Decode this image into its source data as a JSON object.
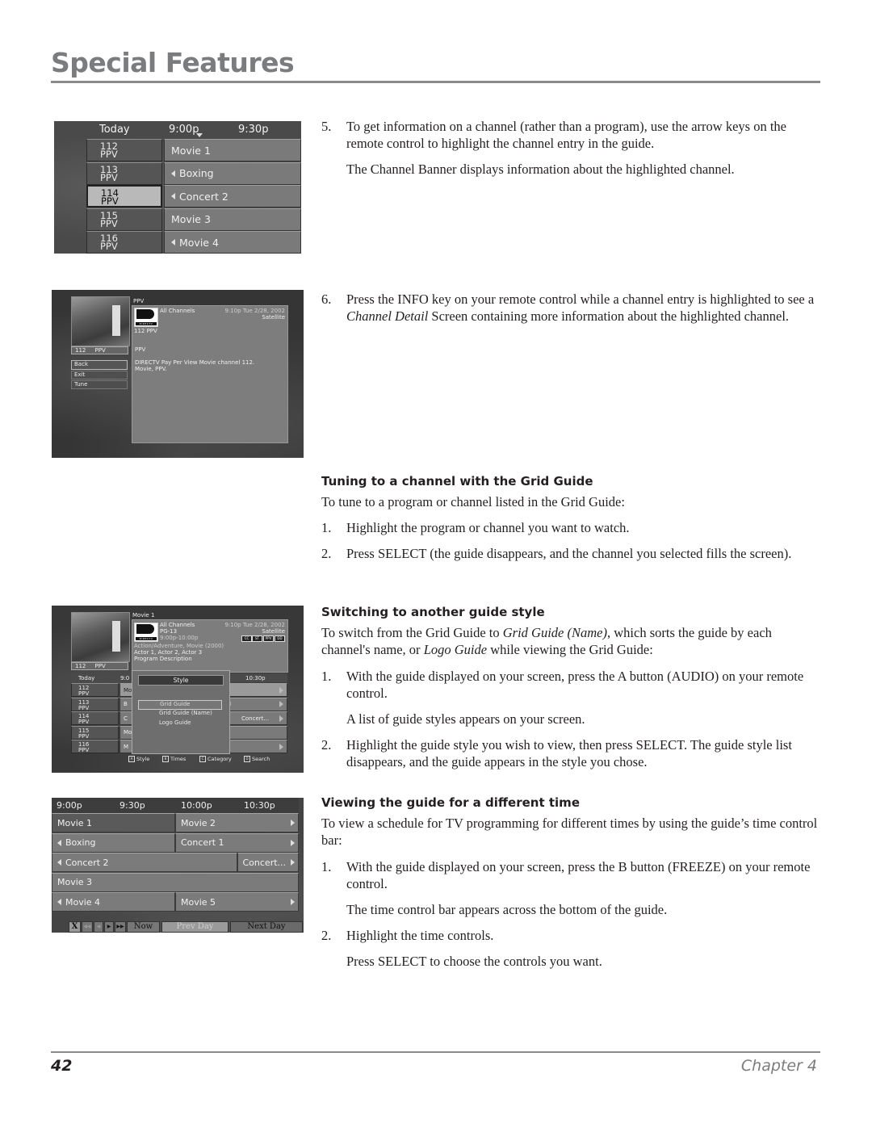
{
  "header": {
    "title": "Special Features"
  },
  "footer": {
    "page_number": "42",
    "chapter": "Chapter 4"
  },
  "text": {
    "step5": {
      "num": "5.",
      "text": "To get information on a channel (rather than a program), use the arrow keys on the remote control to highlight the channel entry in the guide."
    },
    "step5_note": "The Channel Banner displays information about the highlighted channel.",
    "step6": {
      "num": "6.",
      "pre": "Press the INFO key on your remote control while a channel entry is highlighted to see a ",
      "em": "Channel Detail",
      "post": " Screen containing more information about the highlighted channel."
    },
    "tuning": {
      "heading": "Tuning to a channel with the Grid Guide",
      "intro": "To tune to a program or channel listed in the Grid Guide:",
      "steps": [
        {
          "num": "1.",
          "text": "Highlight the program or channel you want to watch."
        },
        {
          "num": "2.",
          "text": "Press SELECT (the guide disappears, and the channel you selected fills the screen)."
        }
      ]
    },
    "switching": {
      "heading": "Switching to another guide style",
      "intro_pre": "To switch from the Grid Guide to ",
      "intro_em1": "Grid Guide (Name)",
      "intro_mid": ", which sorts the guide by each channel's name, or ",
      "intro_em2": "Logo Guide",
      "intro_post": " while viewing the Grid Guide:",
      "steps": [
        {
          "num": "1.",
          "text": "With the guide displayed on your screen, press the A button (AUDIO) on your remote control."
        },
        {
          "num": "2.",
          "text": "Highlight the guide style you wish to view, then press SELECT. The guide style list disappears, and the guide appears in the style you chose."
        }
      ],
      "step1_note": "A list of guide styles appears on your screen."
    },
    "viewing": {
      "heading": "Viewing the guide for a different time",
      "intro": "To view a schedule for TV programming for different times by using the guide’s time control bar:",
      "steps": [
        {
          "num": "1.",
          "text": "With the guide displayed on your screen, press the B button (FREEZE) on your remote control."
        },
        {
          "num": "2.",
          "text": "Highlight the time controls."
        }
      ],
      "step1_note": "The time control bar appears across the bottom of the guide.",
      "step2_note": "Press SELECT to choose the controls you want."
    }
  },
  "screen1": {
    "header": {
      "day": "Today",
      "time1": "9:00p",
      "time2": "9:30p"
    },
    "rows": [
      {
        "channel": "112",
        "type": "PPV",
        "program": "Movie 1",
        "continues_left": false,
        "selected": false
      },
      {
        "channel": "113",
        "type": "PPV",
        "program": "Boxing",
        "continues_left": true,
        "selected": false
      },
      {
        "channel": "114",
        "type": "PPV",
        "program": "Concert 2",
        "continues_left": true,
        "selected": true
      },
      {
        "channel": "115",
        "type": "PPV",
        "program": "Movie 3",
        "continues_left": false,
        "selected": false
      },
      {
        "channel": "116",
        "type": "PPV",
        "program": "Movie 4",
        "continues_left": true,
        "selected": false
      }
    ]
  },
  "screen2": {
    "section_label": "PPV",
    "thumb_label": {
      "channel": "112",
      "type": "PPV"
    },
    "menu": [
      "Back",
      "Exit",
      "Tune"
    ],
    "info": {
      "list": "All Channels",
      "datetime": "9:10p Tue 2/28, 2002",
      "source": "Satellite",
      "logo": "DIRECTV",
      "channel_line": "112  PPV",
      "name": "PPV",
      "description": "DIRECTV Pay Per View Movie channel 112. Movie, PPV."
    }
  },
  "screen3": {
    "program_title": "Movie 1",
    "info": {
      "list": "All Channels",
      "rating": "PG-13",
      "time": "9:00p-10:00p",
      "datetime": "9:10p Tue 2/28, 2002",
      "source": "Satellite",
      "logo": "DIRECTV",
      "genre": "Action/Adventure, Movie (2000)",
      "actors": "Actor 1, Actor 2, Actor 3",
      "description": "Program Description",
      "icons": [
        "cc-icon",
        "stereo-icon",
        "ppv-icon",
        "dd-icon"
      ],
      "icon_labels": [
        "CC",
        "ST",
        "PPV",
        "DD"
      ]
    },
    "thumb_label": {
      "channel": "112",
      "type": "PPV"
    },
    "grid_header": {
      "day": "Today",
      "time1": "9:0",
      "time2": "10:30p"
    },
    "channels": [
      {
        "channel": "112",
        "type": "PPV",
        "prog": "Mo"
      },
      {
        "channel": "113",
        "type": "PPV",
        "prog": "B"
      },
      {
        "channel": "114",
        "type": "PPV",
        "prog": "C"
      },
      {
        "channel": "115",
        "type": "PPV",
        "prog": "Mo"
      },
      {
        "channel": "116",
        "type": "PPV",
        "prog": "M"
      }
    ],
    "right_cells": [
      "",
      "I",
      "Concert...",
      "",
      ""
    ],
    "popup": {
      "title": "Style",
      "options": [
        "Grid Guide",
        "Grid Guide (Name)",
        "Logo Guide"
      ],
      "selected_index": 0
    },
    "legend": [
      {
        "key": "A",
        "label": "Style"
      },
      {
        "key": "B",
        "label": "Times"
      },
      {
        "key": "C",
        "label": "Category"
      },
      {
        "key": "D",
        "label": "Search"
      }
    ]
  },
  "screen4": {
    "times": [
      "9:00p",
      "9:30p",
      "10:00p",
      "10:30p"
    ],
    "rows": [
      [
        {
          "title": "Movie 1",
          "left": false,
          "right": false,
          "span": "half",
          "dark": true
        },
        {
          "title": "Movie 2",
          "left": false,
          "right": true,
          "span": "half"
        }
      ],
      [
        {
          "title": "Boxing",
          "left": true,
          "right": false,
          "span": "half"
        },
        {
          "title": "Concert 1",
          "left": false,
          "right": true,
          "span": "half"
        }
      ],
      [
        {
          "title": "Concert 2",
          "left": true,
          "right": false,
          "span": "three-quarter"
        },
        {
          "title": "Concert...",
          "left": false,
          "right": true,
          "span": "quarter"
        }
      ],
      [
        {
          "title": "Movie 3",
          "left": false,
          "right": false,
          "span": "full"
        }
      ],
      [
        {
          "title": "Movie 4",
          "left": true,
          "right": false,
          "span": "half"
        },
        {
          "title": "Movie 5",
          "left": false,
          "right": true,
          "span": "half"
        }
      ]
    ],
    "controls": {
      "close": "X",
      "rewind_fast": "◀◀",
      "rewind": "◀",
      "forward": "▶",
      "forward_fast": "▶▶",
      "now": "Now",
      "prev_day": "Prev Day",
      "next_day": "Next Day"
    }
  }
}
